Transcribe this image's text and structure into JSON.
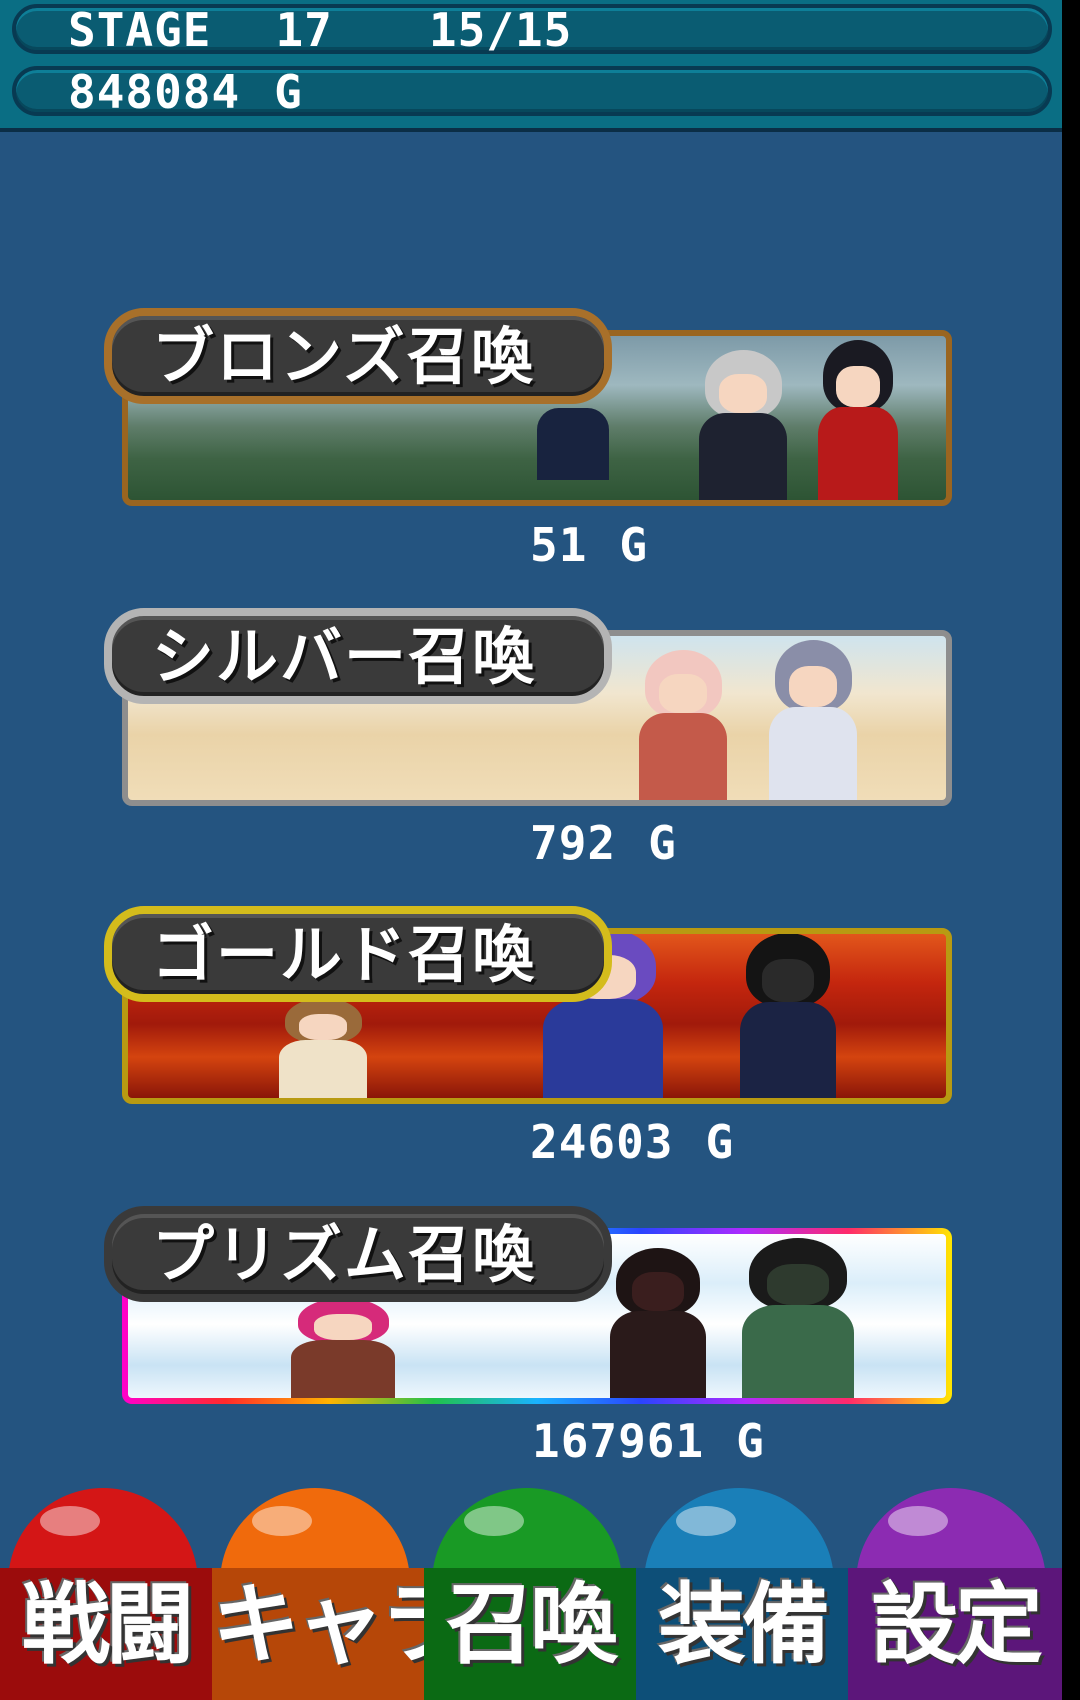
{
  "header": {
    "stage_label": "STAGE",
    "stage_number": "17",
    "wave_progress": "15/15",
    "gold_amount": "848084",
    "gold_unit": "G"
  },
  "summons": [
    {
      "label": "ブロンズ召喚",
      "cost": "51",
      "unit": "G"
    },
    {
      "label": "シルバー召喚",
      "cost": "792",
      "unit": "G"
    },
    {
      "label": "ゴールド召喚",
      "cost": "24603",
      "unit": "G"
    },
    {
      "label": "プリズム召喚",
      "cost": "167961",
      "unit": "G"
    }
  ],
  "nav": [
    {
      "label": "戦闘",
      "color": "#d41616"
    },
    {
      "label": "キャラ",
      "color": "#f06a0c"
    },
    {
      "label": "召喚",
      "color": "#199a25"
    },
    {
      "label": "装備",
      "color": "#1a7fb8"
    },
    {
      "label": "設定",
      "color": "#8c2bb2"
    }
  ]
}
